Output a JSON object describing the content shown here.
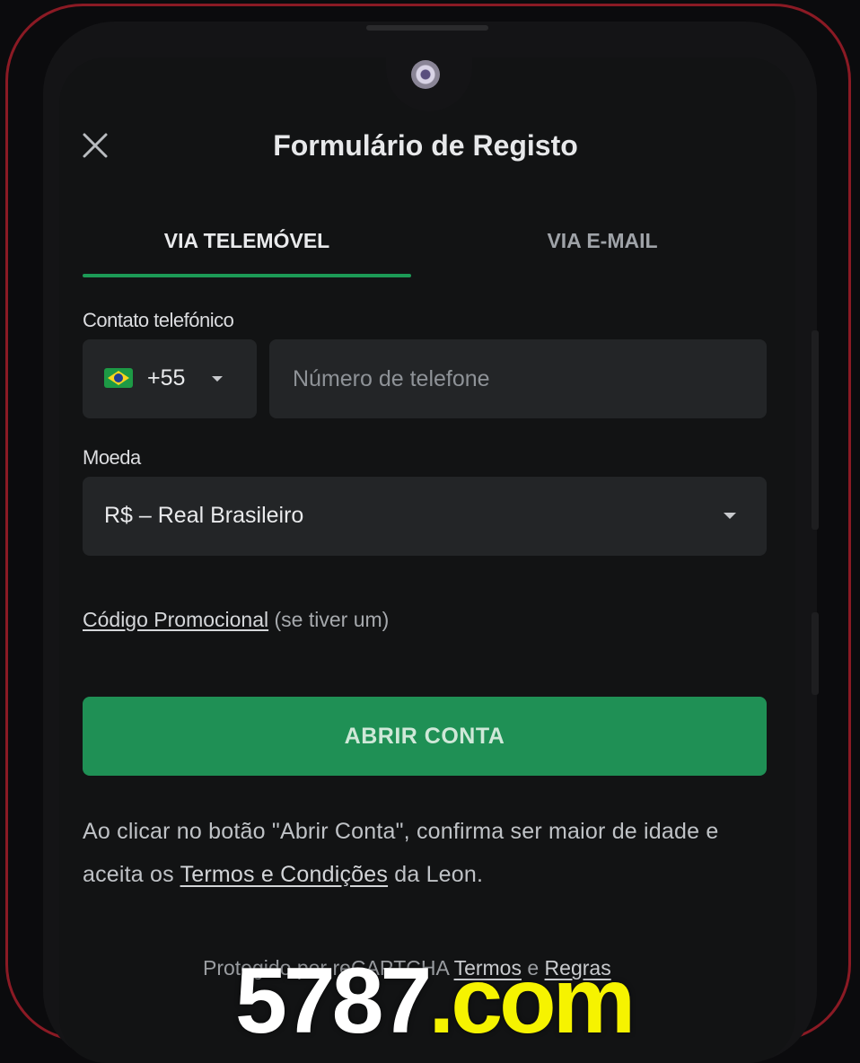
{
  "header": {
    "title": "Formulário de Registo",
    "close_icon": "close-icon"
  },
  "tabs": [
    {
      "label": "VIA TELEMÓVEL",
      "active": true
    },
    {
      "label": "VIA E-MAIL",
      "active": false
    }
  ],
  "phone_section": {
    "label": "Contato telefónico",
    "country_flag": "brazil-flag-icon",
    "country_code": "+55",
    "phone_placeholder": "Número de telefone",
    "phone_value": ""
  },
  "currency_section": {
    "label": "Moeda",
    "selected": "R$ – Real Brasileiro"
  },
  "promo": {
    "link": "Código Promocional",
    "suffix": "(se tiver um)"
  },
  "submit_label": "ABRIR CONTA",
  "disclaimer": {
    "text_before": "Ao clicar no botão \"Abrir Conta\", confirma ser maior de idade e aceita os",
    "terms_link": "Termos e Condições",
    "text_after": "da Leon."
  },
  "captcha_notice": {
    "text": "Protegido por reCAPTCHA",
    "terms_link": "Termos",
    "and": "e",
    "rules_link": "Regras"
  },
  "watermark": {
    "number": "5787",
    "domain": ".com"
  },
  "colors": {
    "accent_green": "#1f9055",
    "tab_underline": "#1c9a56",
    "frame_border": "#8b1a24",
    "watermark_yellow": "#f6f300"
  }
}
